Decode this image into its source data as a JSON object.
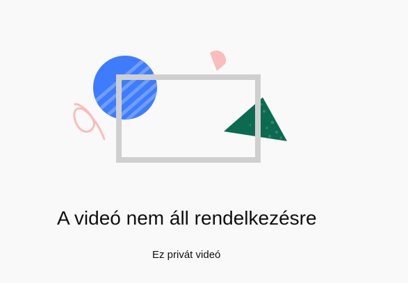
{
  "error": {
    "title": "A videó nem áll rendelkezésre",
    "subtitle": "Ez privát videó"
  },
  "illustration": {
    "icons": [
      "blue-circle-icon",
      "pink-squiggle-icon",
      "pink-half-circle-icon",
      "gray-frame-icon",
      "green-triangle-icon"
    ],
    "colors": {
      "blue": "#3d7cff",
      "blue_stripe": "#7aa5ff",
      "pink": "#fbbcbc",
      "gray": "#cfcfcf",
      "green": "#0b6b50",
      "green_speckle": "#2e8a68",
      "background": "#f9f9f9"
    }
  }
}
